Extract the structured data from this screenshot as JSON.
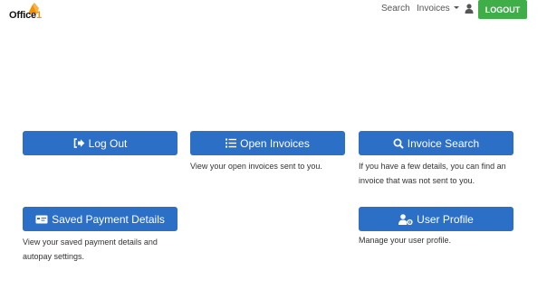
{
  "header": {
    "logo_main": "Office",
    "logo_suffix": "1",
    "search_link": "Search",
    "invoices_link": "Invoices",
    "logout_label": "LOGOUT"
  },
  "cards": {
    "logout": {
      "label": "Log Out",
      "icon": "sign-out-icon"
    },
    "open_invoices": {
      "label": "Open Invoices",
      "icon": "list-icon",
      "description": "View your open invoices sent to you."
    },
    "invoice_search": {
      "label": "Invoice Search",
      "icon": "search-icon",
      "description": "If you have a few details, you can find an invoice that was not sent to you."
    },
    "saved_payment": {
      "label": "Saved Payment Details",
      "icon": "credit-card-icon",
      "description": "View your saved payment details and autopay settings."
    },
    "user_profile": {
      "label": "User Profile",
      "icon": "user-cog-icon",
      "description": "Manage your user profile."
    }
  },
  "colors": {
    "primary": "#2b6fc6",
    "logout_green": "#3fae49",
    "brand_orange": "#f39200"
  }
}
